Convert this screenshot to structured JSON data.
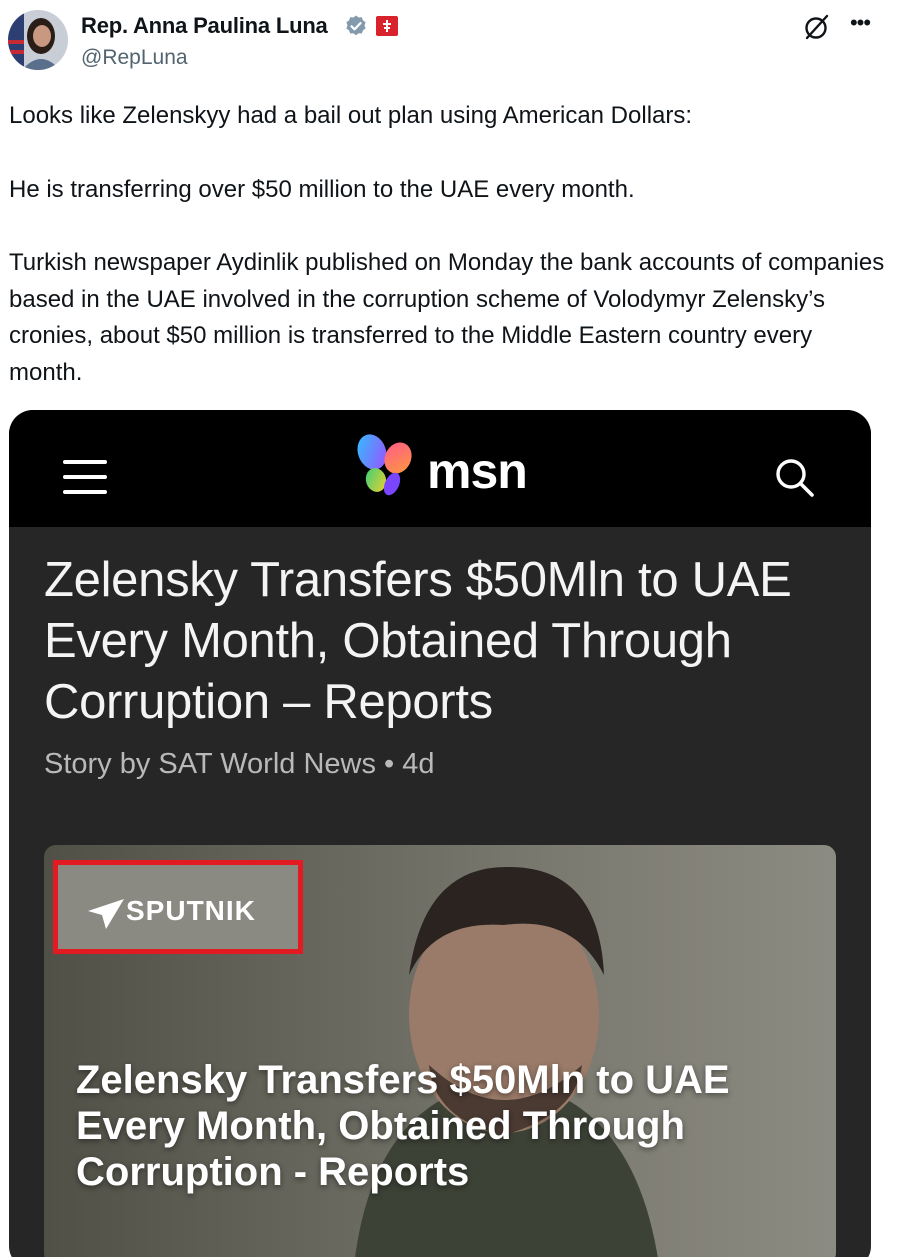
{
  "tweet": {
    "author": {
      "name": "Rep. Anna Paulina Luna",
      "handle": "@RepLuna",
      "verified_color": "#829aab",
      "flag_color": "#d8222c"
    },
    "paragraphs": [
      "Looks like Zelenskyy had a bail out plan using American Dollars:",
      "He is transferring over $50 million to the UAE every month.",
      "Turkish newspaper Aydinlik published on Monday the bank accounts of companies based in the UAE involved in the corruption scheme of Volodymyr Zelensky’s cronies, about $50 million is transferred to the Middle Eastern country every month."
    ],
    "icons": {
      "grok": "grok-icon",
      "more": "more-icon"
    }
  },
  "media": {
    "header": {
      "brand": "msn",
      "menu_icon": "hamburger-menu-icon",
      "search_icon": "search-icon"
    },
    "article": {
      "title": "Zelensky Transfers $50Mln to UAE Every Month, Obtained Through Corruption – Reports",
      "byline": "Story by SAT World News • 4d",
      "image": {
        "source_label": "SPUTNIK",
        "highlight_color": "#e21a22",
        "headline": "Zelensky Transfers $50Mln to UAE Every Month, Obtained Through Corruption - Reports"
      }
    }
  }
}
